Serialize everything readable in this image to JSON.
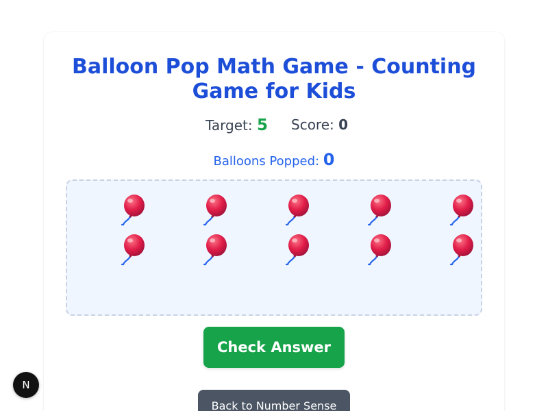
{
  "title": {
    "line1": "Balloon Pop Math Game - Counting",
    "line2": "Game for Kids"
  },
  "stats": {
    "target_label": "Target:",
    "target_value": "5",
    "score_label": "Score:",
    "score_value": "0",
    "popped_label": "Balloons Popped:",
    "popped_value": "0"
  },
  "balloons": {
    "count": 10,
    "icon": "balloon-icon",
    "color": "#e11d48",
    "string_color": "#2563eb"
  },
  "buttons": {
    "check_label": "Check Answer",
    "back_label": "Back to Number Sense"
  },
  "badge": {
    "label": "N"
  },
  "colors": {
    "title": "#1d4ed8",
    "target": "#16a34a",
    "popped": "#2563eb",
    "check_button": "#16a34a",
    "back_button": "#4b5563",
    "play_area_bg": "#eff6ff"
  }
}
